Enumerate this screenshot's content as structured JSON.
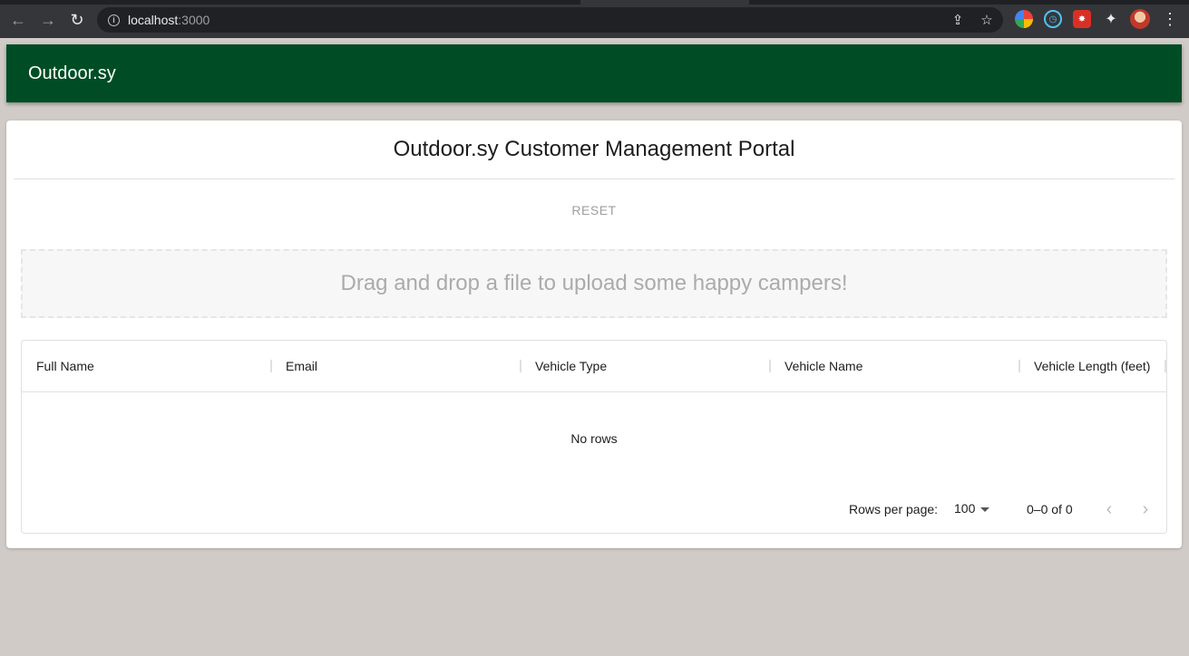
{
  "browser": {
    "url_host": "localhost",
    "url_port": ":3000"
  },
  "icons": {
    "back": "←",
    "forward": "→",
    "reload": "↻",
    "info": "i",
    "share": "⇪",
    "star": "☆",
    "puzzle": "✦",
    "menu": "⋮",
    "prev": "‹",
    "next": "›",
    "ext_b": "◷",
    "ext_c": "✸"
  },
  "appbar": {
    "title": "Outdoor.sy"
  },
  "card": {
    "title": "Outdoor.sy Customer Management Portal",
    "reset_label": "RESET"
  },
  "dropzone": {
    "text": "Drag and drop a file to upload some happy campers!"
  },
  "grid": {
    "columns": [
      "Full Name",
      "Email",
      "Vehicle Type",
      "Vehicle Name",
      "Vehicle Length (feet)"
    ],
    "empty_text": "No rows",
    "rows_per_page_label": "Rows per page:",
    "rows_per_page_value": "100",
    "page_info": "0–0 of 0"
  },
  "colors": {
    "appbar": "#004d25",
    "page_background": "#d1cbc7"
  }
}
